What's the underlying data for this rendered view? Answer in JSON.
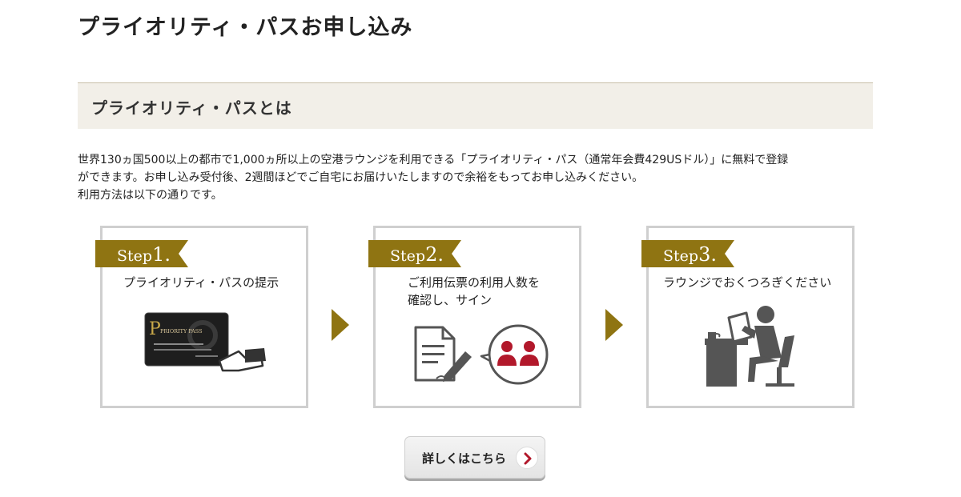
{
  "page": {
    "title": "プライオリティ・パスお申し込み"
  },
  "section": {
    "title": "プライオリティ・パスとは"
  },
  "intro": {
    "line1": "世界130ヵ国500以上の都市で1,000ヵ所以上の空港ラウンジを利用できる「プライオリティ・パス（通常年会費429USドル）」に無料で登録",
    "line2": "ができます。お申し込み受付後、2週間ほどでご自宅にお届けいたしますので余裕をもってお申し込みください。",
    "line3": "利用方法は以下の通りです。"
  },
  "steps": [
    {
      "label": "Step",
      "number": "1.",
      "description_line1": "プライオリティ・パスの提示",
      "description_line2": "",
      "icon": "priority-pass-card-icon"
    },
    {
      "label": "Step",
      "number": "2.",
      "description_line1": "ご利用伝票の利用人数を",
      "description_line2": "確認し、サイン",
      "icon": "sign-document-icon"
    },
    {
      "label": "Step",
      "number": "3.",
      "description_line1": "ラウンジでおくつろぎください",
      "description_line2": "",
      "icon": "lounge-relax-icon"
    }
  ],
  "card": {
    "brand": "PRIORITY PASS",
    "letter": "P"
  },
  "more_button": {
    "label": "詳しくはこちら",
    "icon": "chevron-right-icon"
  },
  "colors": {
    "gold": "#8f7412",
    "header_bg": "#f2efe8",
    "accent_red": "#b2182b",
    "icon_gray": "#555555"
  }
}
